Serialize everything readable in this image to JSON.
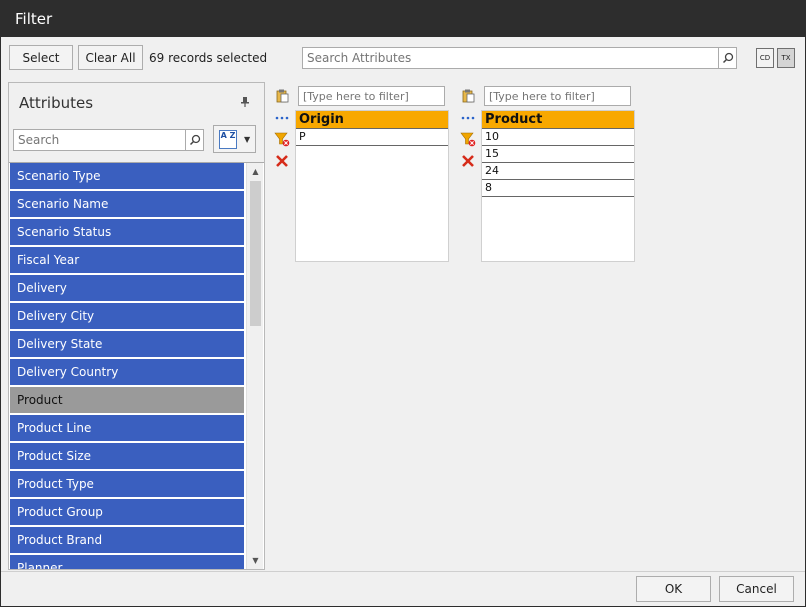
{
  "window": {
    "title": "Filter"
  },
  "toolbar": {
    "select_label": "Select",
    "clear_all_label": "Clear All",
    "records_text": "69 records selected",
    "search_placeholder": "Search Attributes",
    "toggle_cd": "CD",
    "toggle_tx": "TX"
  },
  "attributes_panel": {
    "title": "Attributes",
    "search_placeholder": "Search",
    "sort_icon_text": "A Z",
    "items": [
      {
        "label": "Scenario Type",
        "selected": false
      },
      {
        "label": "Scenario Name",
        "selected": false
      },
      {
        "label": "Scenario Status",
        "selected": false
      },
      {
        "label": "Fiscal Year",
        "selected": false
      },
      {
        "label": "Delivery",
        "selected": false
      },
      {
        "label": "Delivery City",
        "selected": false
      },
      {
        "label": "Delivery State",
        "selected": false
      },
      {
        "label": "Delivery Country",
        "selected": false
      },
      {
        "label": "Product",
        "selected": true
      },
      {
        "label": "Product Line",
        "selected": false
      },
      {
        "label": "Product Size",
        "selected": false
      },
      {
        "label": "Product Type",
        "selected": false
      },
      {
        "label": "Product Group",
        "selected": false
      },
      {
        "label": "Product Brand",
        "selected": false
      },
      {
        "label": "Planner",
        "selected": false
      }
    ]
  },
  "filter_columns": [
    {
      "filter_placeholder": "[Type here to filter]",
      "header": "Origin",
      "values": [
        "P"
      ]
    },
    {
      "filter_placeholder": "[Type here to filter]",
      "header": "Product",
      "values": [
        "10",
        "15",
        "24",
        "8"
      ]
    }
  ],
  "footer": {
    "ok_label": "OK",
    "cancel_label": "Cancel"
  },
  "colors": {
    "title_bar": "#2d2d2d",
    "list_item": "#3a5fbf",
    "list_item_selected": "#9a9a9a",
    "column_header": "#f8a800"
  }
}
